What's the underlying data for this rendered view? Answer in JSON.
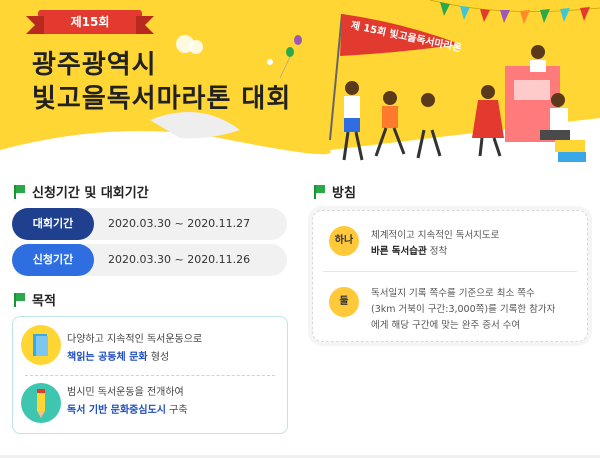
{
  "banner": {
    "edition": "제15회",
    "title_line1": "광주광역시",
    "title_line2": "빛고을독서마라톤 대회",
    "flag_text": "제 15회 빛고을독서마라톤"
  },
  "schedule": {
    "heading": "신청기간 및 대회기간",
    "rows": [
      {
        "label": "대회기간",
        "value": "2020.03.30 ~ 2020.11.27",
        "color": "#1f3f8f"
      },
      {
        "label": "신청기간",
        "value": "2020.03.30 ~ 2020.11.26",
        "color": "#2f6ee0"
      }
    ]
  },
  "purpose": {
    "heading": "목적",
    "items": [
      {
        "icon": "book-icon",
        "line1": "다양하고 지속적인 독서운동으로",
        "highlight": "책읽는 공동체 문화",
        "suffix": " 형성"
      },
      {
        "icon": "pencil-icon",
        "line1": "범시민 독서운동을 전개하여",
        "highlight": "독서 기반 문화중심도시",
        "suffix": " 구축"
      }
    ]
  },
  "policy": {
    "heading": "방침",
    "items": [
      {
        "num": "하나",
        "line1": "체계적이고 지속적인 독서지도로",
        "bold": "바른 독서습관",
        "suffix": " 정착"
      },
      {
        "num": "둘",
        "line1": "독서일지 기록 쪽수를 기준으로 최소 쪽수",
        "line2": "(3km 거북이 구간:3,000쪽)를 기록한 참가자",
        "line3": "에게 해당 구간에 맞는 완주 증서 수여"
      }
    ]
  },
  "colors": {
    "banner": "#ffd633",
    "accent_green": "#2aa84a",
    "highlight_blue": "#1f4ec2",
    "badge_yellow": "#ffc93a"
  }
}
